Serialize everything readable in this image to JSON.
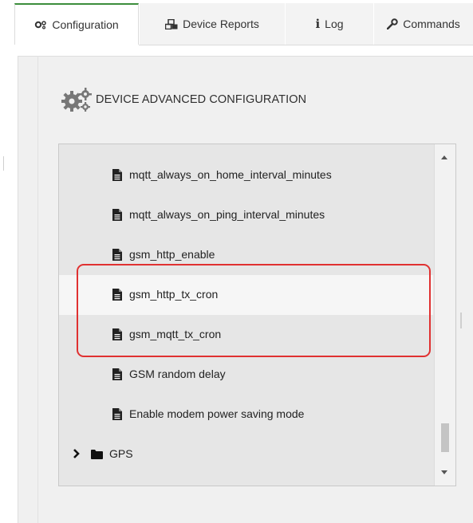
{
  "tabs": [
    {
      "label": "Configuration",
      "icon": "gears-icon",
      "active": true
    },
    {
      "label": "Device Reports",
      "icon": "cubes-icon",
      "active": false
    },
    {
      "label": "Log",
      "icon": "info-icon",
      "active": false
    },
    {
      "label": "Commands",
      "icon": "wrench-icon",
      "active": false
    }
  ],
  "section": {
    "title": "DEVICE ADVANCED CONFIGURATION",
    "icon": "gears-icon"
  },
  "tree": {
    "items": [
      {
        "label": "mqtt_always_on_home_interval_minutes",
        "icon": "file-icon"
      },
      {
        "label": "mqtt_always_on_ping_interval_minutes",
        "icon": "file-icon"
      },
      {
        "label": "gsm_http_enable",
        "icon": "file-icon"
      },
      {
        "label": "gsm_http_tx_cron",
        "icon": "file-icon",
        "highlighted": true
      },
      {
        "label": "gsm_mqtt_tx_cron",
        "icon": "file-icon"
      },
      {
        "label": "GSM random delay",
        "icon": "file-icon"
      },
      {
        "label": "Enable modem power saving mode",
        "icon": "file-icon"
      }
    ],
    "folder": {
      "label": "GPS",
      "icon": "folder-icon",
      "expanded": false
    }
  },
  "colors": {
    "accent": "#3c8d3c",
    "highlight_box": "#e03131",
    "tree_bg": "#e6e6e6"
  }
}
